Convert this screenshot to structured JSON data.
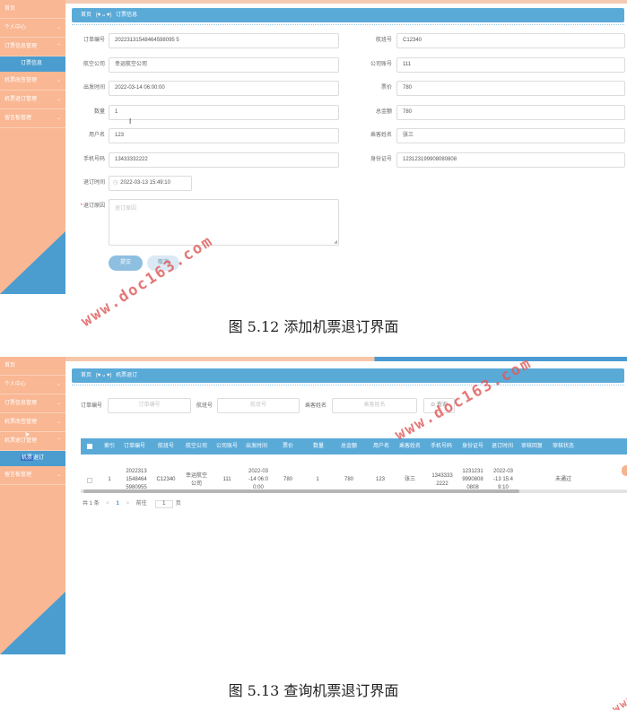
{
  "sidebar_items": [
    "首页",
    "个人中心",
    "订票信息管理",
    "订票信息",
    "机票改签管理",
    "机票退订管理",
    "留言板管理"
  ],
  "shot2_sidebar_items": [
    "首页",
    "个人中心",
    "订票信息管理",
    "机票改签管理",
    "机票退订管理",
    "机票退订",
    "留言板管理"
  ],
  "shot2_submenu_highlight": "机票",
  "shot2_submenu_rest": "退订",
  "shot1": {
    "crumb_home": "首页",
    "crumb_current": "订票信息",
    "fields": {
      "order_no": {
        "label": "订单编号",
        "value": "20223131548464598095 5"
      },
      "flight_no": {
        "label": "航班号",
        "value": "C12340"
      },
      "airline": {
        "label": "航空公司",
        "value": "幸运航空公司"
      },
      "company_account": {
        "label": "公司账号",
        "value": "111"
      },
      "depart_time": {
        "label": "出发时间",
        "value": "2022-03-14 06:00:00"
      },
      "price": {
        "label": "票价",
        "value": "780"
      },
      "quantity": {
        "label": "数量",
        "value": "1"
      },
      "total": {
        "label": "总金额",
        "value": "780"
      },
      "username": {
        "label": "用户名",
        "value": "123"
      },
      "passenger": {
        "label": "乘客姓名",
        "value": "张三"
      },
      "phone": {
        "label": "手机号码",
        "value": "13433332222"
      },
      "id_card": {
        "label": "身份证号",
        "value": "123123199908080808"
      },
      "refund_time": {
        "label": "退订时间",
        "value": "2022-03-13 15:49:10"
      },
      "refund_reason": {
        "label": "退订原因",
        "placeholder": "退订原因"
      }
    },
    "submit_label": "提交",
    "cancel_label": "取消"
  },
  "shot2": {
    "crumb_home": "首页",
    "crumb_current": "机票退订",
    "search": {
      "order_label": "订单编号",
      "order_placeholder": "订单编号",
      "flight_label": "航班号",
      "flight_placeholder": "航班号",
      "passenger_label": "乘客姓名",
      "passenger_placeholder": "乘客姓名",
      "button": "查询"
    },
    "table": {
      "headers": [
        "索引",
        "订单编号",
        "航班号",
        "航空公司",
        "公司账号",
        "出发时间",
        "票价",
        "数量",
        "总金额",
        "用户名",
        "乘客姓名",
        "手机号码",
        "身份证号",
        "退订时间",
        "审核回复",
        "审核状态"
      ],
      "row": [
        "1",
        "2022313\n1548464\n5980955",
        "C12340",
        "幸运航空\n公司",
        "111",
        "2022-03\n-14 06:0\n0:00",
        "780",
        "1",
        "780",
        "123",
        "张三",
        "1343333\n2222",
        "1231231\n9990808\n0808",
        "2022-03\n-13 15:4\n9:10",
        "",
        "未通过"
      ]
    },
    "pager": {
      "total": "共 1 条",
      "prev": "<",
      "page": "1",
      "next": ">",
      "goto": "前往",
      "goto_value": "1",
      "unit": "页"
    }
  },
  "captions": {
    "fig1": "图 5.12 添加机票退订界面",
    "fig2": "图 5.13 查询机票退订界面"
  },
  "watermark": "www.doc163.com",
  "colors": {
    "sidebar": "#f9b793",
    "accent": "#5aaad8",
    "submenu": "#4b9dcf"
  }
}
